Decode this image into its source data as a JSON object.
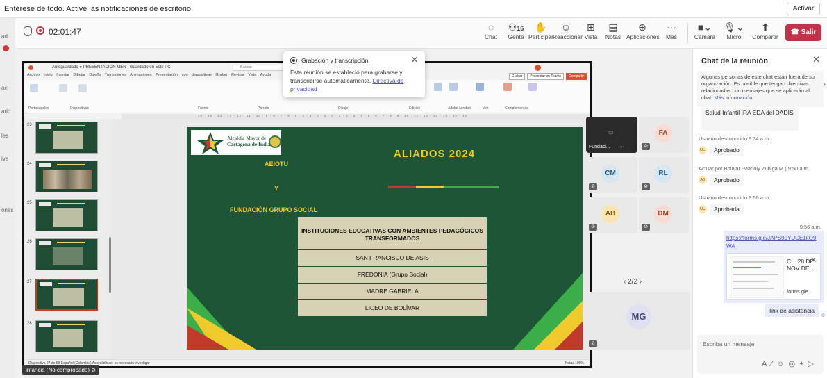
{
  "notification": {
    "text": "Entérese de todo. Active las notificaciones de escritorio.",
    "button": "Activar"
  },
  "rail": {
    "labels": [
      "ad",
      "ac",
      "ario",
      "les",
      "ive",
      "ones"
    ]
  },
  "meeting": {
    "timer": "02:01:47"
  },
  "toolbar": {
    "chat": "Chat",
    "people": "Gente",
    "people_count": "16",
    "raise": "Participar",
    "react": "Reaccionar",
    "view": "Vista",
    "notes": "Notas",
    "apps": "Aplicaciones",
    "more": "Más",
    "camera": "Cámara",
    "mic": "Micro",
    "share": "Compartir",
    "leave": "Salir"
  },
  "ppt": {
    "title": "Autoguardado  ●  PRESENTACION MEN - Guardado en Este PC",
    "search": "Buscar",
    "menu": "Archivo  Inicio  Insertar  Dibujar  Diseño  Transiciones  Animaciones  Presentación con diapositivas  Grabar  Revisar  Vista  Ayuda",
    "grabar": "Grabar",
    "present_teams": "Presentar en Teams",
    "compartir": "Compartir",
    "groups": [
      "Portapapeles",
      "Diapositivas",
      "Fuente",
      "Párrafo",
      "Dibujo",
      "Edición",
      "Adobe Acrobat",
      "Voz",
      "Complementos"
    ],
    "ruler": "16 · 15 · 14 · 13 · 12 · 11 · 10 · 9 · 8 · 7 · 6 · 5 · 4 · 3 · 2 · 1 · 0 · 1 · 2 · 3 · 4 · 5 · 6 · 7 · 8 · 9 · 10 · 11 · 12 · 13 · 14 · 15 · 16",
    "status_left": "Diapositiva 27 de 59   Español (Colombia)   Accesibilidad: es necesario investigar",
    "status_right": "Notas   100%",
    "thumbs": [
      "23",
      "24",
      "25",
      "26",
      "27",
      "28"
    ]
  },
  "slide": {
    "logo_line1": "Alcaldía Mayor de",
    "logo_line2": "Cartagena de Indias",
    "title": "ALIADOS 2024",
    "org1": "AEIOTU",
    "conj": "Y",
    "org2": "FUNDACIÓN GRUPO SOCIAL",
    "table_header": "INSTITUCIONES EDUCATIVAS CON AMBIENTES PEDAGÓGICOS TRANSFORMADOS",
    "rows": [
      "SAN FRANCISCO DE ASIS",
      "FREDONIA (Grupo Social)",
      "MADRE GABRIELA",
      "LICEO DE BOLÍVAR"
    ]
  },
  "popup": {
    "title": "Grabación y transcripción",
    "body": "Esta reunión se estableció para grabarse y transcribirse automáticamente.",
    "link": "Directiva de privacidad"
  },
  "participants": {
    "self_name": "Fundaci...",
    "tiles": [
      "FA",
      "CM",
      "RL",
      "AB",
      "DM"
    ],
    "big": "MG",
    "pager": "2/2",
    "bottom_name": "infancia (No comprobado)"
  },
  "chat": {
    "title": "Chat de la reunión",
    "notice": "Algunas personas de este chat están fuera de su organización. Es posible que tengan directivas relacionadas con mensajes que se aplicarán al chat.",
    "notice_link": "Más información",
    "cut_msg": "Salud Infantil IRA EDA del DADIS",
    "messages": [
      {
        "meta": "Usuario desconocido  9:34 a.m.",
        "initials": "UU",
        "text": "Aprobado"
      },
      {
        "meta": "Actuar por Bolívar -Marioly Zuñiga M (  9:50 a.m.",
        "initials": "AB",
        "text": "Aprobado"
      },
      {
        "meta": "Usuario desconocido  9:50 a.m.",
        "initials": "UU",
        "text": "Aprobada"
      }
    ],
    "my_time": "9:56 a.m.",
    "my_link": "https://forms.gle/JAPS99YUCE1kO9WA",
    "preview_title": "C... 28 DE NOV DE...",
    "preview_domain": "forms.gle",
    "my_msg2": "link de asistencia",
    "compose_placeholder": "Escriba un mensaje"
  }
}
